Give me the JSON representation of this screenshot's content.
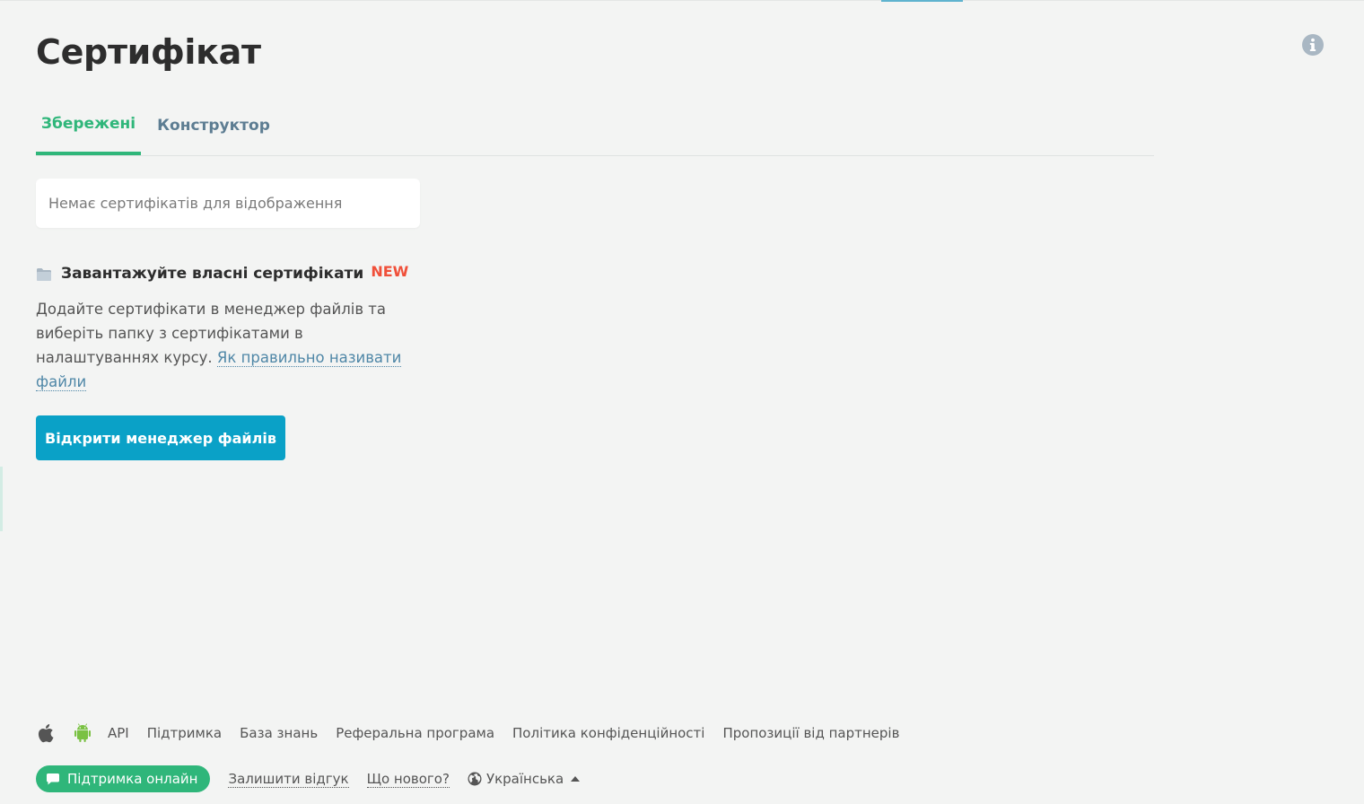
{
  "page": {
    "title": "Сертифікат"
  },
  "tabs": [
    {
      "label": "Збережені",
      "active": true
    },
    {
      "label": "Конструктор",
      "active": false
    }
  ],
  "saved": {
    "empty_message": "Немає сертифікатів для відображення"
  },
  "upload": {
    "title": "Завантажуйте власні сертифікати",
    "badge": "NEW",
    "text": "Додайте сертифікати в менеджер файлів та виберіть папку з сертифікатами в налаштуваннях курсу. ",
    "link": "Як правильно називати файли",
    "button": "Відкрити менеджер файлів"
  },
  "footer": {
    "links": [
      "API",
      "Підтримка",
      "База знань",
      "Реферальна програма",
      "Політика конфіденційності",
      "Пропозиції від партнерів"
    ],
    "support_chat": "Підтримка онлайн",
    "feedback": "Залишити відгук",
    "whats_new": "Що нового?",
    "language": "Українська"
  },
  "icons": {
    "info": "info-circle-icon",
    "folder": "folder-icon",
    "apple": "apple-icon",
    "android": "android-icon",
    "chat": "chat-bubble-icon",
    "globe": "globe-icon",
    "caret": "caret-up-icon"
  },
  "colors": {
    "accent_green": "#2fb67a",
    "button_blue": "#0aa1c7",
    "new_badge": "#f0503a",
    "link": "#4f87a7",
    "tab_inactive": "#5d7d92"
  }
}
